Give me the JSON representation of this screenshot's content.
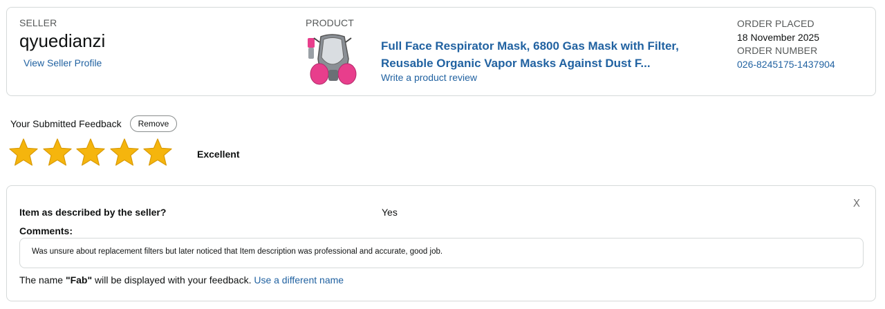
{
  "order": {
    "seller_label": "SELLER",
    "seller_name": "qyuedianzi",
    "seller_profile_link": "View Seller Profile",
    "product_label": "PRODUCT",
    "product_title_line1": "Full Face Respirator Mask, 6800 Gas Mask with Filter,",
    "product_title_line2": "Reusable Organic Vapor Masks Against Dust F...",
    "review_link": "Write a product review",
    "order_placed_label": "ORDER PLACED",
    "order_placed_date": "18 November 2025",
    "order_number_label": "ORDER NUMBER",
    "order_number": "026-8245175-1437904"
  },
  "feedback": {
    "submitted_label": "Your Submitted Feedback",
    "remove_button": "Remove",
    "rating": 5,
    "rating_max": 5,
    "rating_text": "Excellent",
    "star_color": "#f5b50d"
  },
  "details": {
    "close_glyph": "X",
    "described_question": "Item as described by the seller?",
    "described_answer": "Yes",
    "comments_label": "Comments:",
    "comment_text": "Was unsure about replacement filters but later noticed that Item description was professional and accurate, good job.",
    "name_prefix": "The name ",
    "name_value": "\"Fab\"",
    "name_suffix": " will be displayed with your feedback. ",
    "name_link": "Use a different name"
  },
  "colors": {
    "link": "#2162a1",
    "border": "#d5d9d9",
    "mask_filter_pink": "#e83e8c"
  }
}
